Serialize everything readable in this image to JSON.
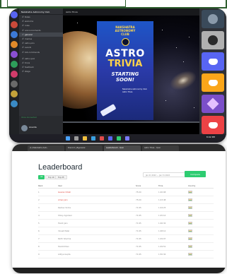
{
  "discord": {
    "server_name": "Nakshatra Astronomy Club",
    "channels": [
      {
        "label": "Rules"
      },
      {
        "label": "welcome"
      },
      {
        "label": "roles"
      },
      {
        "label": "announcements"
      },
      {
        "label": "general",
        "active": true
      },
      {
        "label": "memes"
      },
      {
        "label": "astro-pics"
      },
      {
        "label": "events"
      },
      {
        "label": "bot-commands"
      },
      {
        "label": "astro-quiz"
      },
      {
        "label": "trivia"
      },
      {
        "label": "feedback"
      },
      {
        "label": "stage"
      }
    ],
    "voice_status": "Voice Connected",
    "user": "Ananta",
    "stream_title": "Astro Trivia",
    "poster": {
      "club_line1": "NAKSHATRA",
      "club_line2": "ASTRONOMY",
      "club_line3": "CLUB",
      "astro": "ASTRO",
      "trivia": "TRIVIA",
      "starting1": "STARTING",
      "starting2": "SOON!",
      "info1": "Nakshatra Astronomy Club",
      "info2": "Astro Trivia"
    },
    "participant_colors": [
      "#5865f2",
      "#5865f2",
      "#faa61a",
      "#7b4fc9",
      "#ed4245"
    ],
    "taskbar_time": "8:02 PM"
  },
  "leaderboard": {
    "browser_tabs": [
      "(1) Nakshatra Astr...",
      "Discord | #general",
      "Leaderboard - Quiz",
      "Astro Trivia - Quiz"
    ],
    "title": "Leaderboard",
    "filters": [
      "All",
      "Top 10",
      "Top 25"
    ],
    "date_range": "Jan 01 2022 — Jan 31 2022",
    "compare_label": "Compare",
    "columns": [
      "Rank",
      "User",
      "Score",
      "Time",
      "Country"
    ],
    "rows": [
      {
        "rank": "1",
        "user": "Gauravi Shah",
        "score": "75.00",
        "time": "1:40:08",
        "top": true
      },
      {
        "rank": "2",
        "user": "Aman Jain",
        "score": "75.00",
        "time": "1:43:48",
        "top": true
      },
      {
        "rank": "3",
        "user": "Keshav Sinha",
        "score": "71.95",
        "time": "1:44:23"
      },
      {
        "rank": "4",
        "user": "Shrey Agarwal",
        "score": "71.95",
        "time": "1:45:10"
      },
      {
        "rank": "5",
        "user": "Harsh Jain",
        "score": "71.95",
        "time": "1:46:34"
      },
      {
        "rank": "6",
        "user": "Vineet Patel",
        "score": "71.95",
        "time": "1:48:12"
      },
      {
        "rank": "7",
        "user": "Parth Sharma",
        "score": "71.95",
        "time": "1:49:07"
      },
      {
        "rank": "8",
        "user": "Harshit Rao",
        "score": "71.95",
        "time": "1:49:51"
      },
      {
        "rank": "9",
        "user": "Aditya Gupta",
        "score": "71.95",
        "time": "1:50:34"
      }
    ]
  }
}
